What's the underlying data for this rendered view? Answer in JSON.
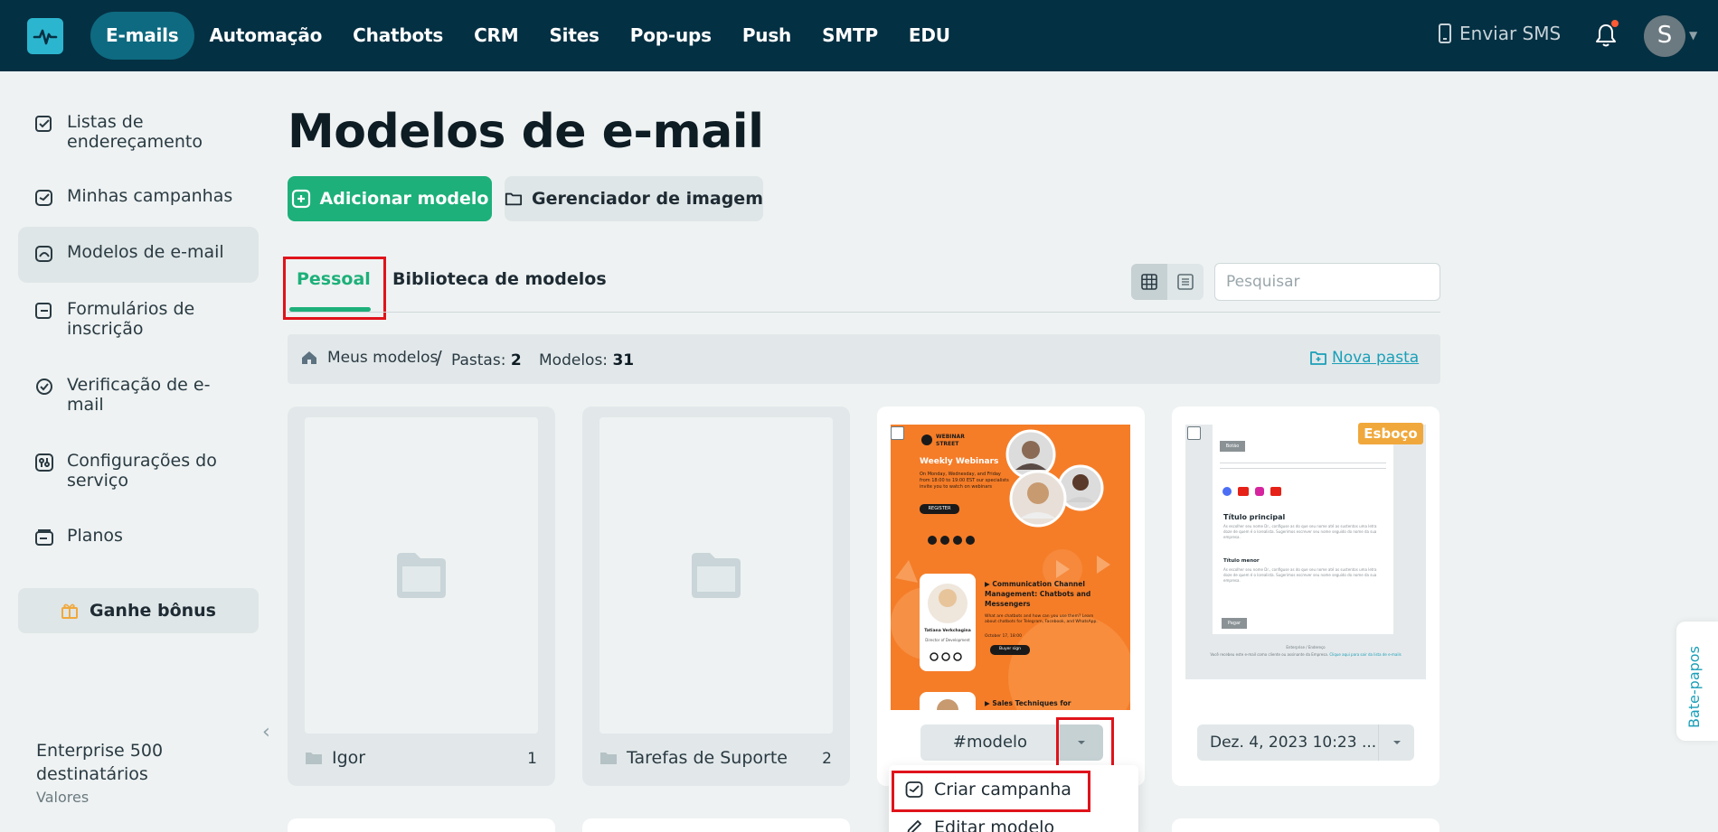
{
  "nav": {
    "items": [
      "E-mails",
      "Automação",
      "Chatbots",
      "CRM",
      "Sites",
      "Pop-ups",
      "Push",
      "SMTP",
      "EDU"
    ],
    "active_index": 0,
    "sms_label": "Enviar SMS",
    "avatar_letter": "S"
  },
  "sidebar": {
    "items": [
      {
        "label": "Listas de endereçamento",
        "icon": "address-list-icon"
      },
      {
        "label": "Minhas campanhas",
        "icon": "campaign-icon"
      },
      {
        "label": "Modelos de e-mail",
        "icon": "template-icon"
      },
      {
        "label": "Formulários de inscrição",
        "icon": "form-icon"
      },
      {
        "label": "Verificação de e-mail",
        "icon": "check-circle-icon"
      },
      {
        "label": "Configurações do serviço",
        "icon": "settings-icon"
      },
      {
        "label": "Planos",
        "icon": "wallet-icon"
      }
    ],
    "active_index": 2,
    "bonus_label": "Ganhe bônus",
    "plan_name": "Enterprise 500 destinatários",
    "plan_values": "Valores"
  },
  "main": {
    "title": "Modelos de e-mail",
    "add_button": "Adicionar modelo",
    "image_manager_button": "Gerenciador de imagem",
    "tabs": [
      "Pessoal",
      "Biblioteca de modelos"
    ],
    "search_placeholder": "Pesquisar",
    "breadcrumb": {
      "root": "Meus modelos",
      "sep": "/",
      "folders_label": "Pastas:",
      "folders_count": "2",
      "templates_label": "Modelos:",
      "templates_count": "31",
      "new_folder": "Nova pasta"
    },
    "folders": [
      {
        "name": "Igor",
        "count": "1"
      },
      {
        "name": "Tarefas de Suporte",
        "count": "2"
      }
    ],
    "templates": [
      {
        "name": "#modelo"
      },
      {
        "date": "Dez. 4, 2023 10:23 ...",
        "badge": "Esboço"
      }
    ],
    "dropdown_menu": [
      "Criar campanha",
      "Editar modelo"
    ]
  },
  "webinar_thumb": {
    "brand": "WEBINAR",
    "brand2": "STREET",
    "heading": "Weekly Webinars",
    "body": "On Monday, Wednesday, and Friday from 18:00 to 19:00 EST our specialists invite you to watch on webinars",
    "register": "REGISTER",
    "talk1_title": "Communication Channel Management: Chatbots and Messengers",
    "talk1_text": "What are chatbots and how can you use them? Learn about chatbots for Telegram, Facebook, and WhatsApp.",
    "talk1_date": "October 17, 18:00",
    "talk1_btn": "Buyer sign",
    "speaker_name": "Tatiana Verkchagina",
    "speaker_role": "Director of Development",
    "talk2_title": "Sales Techniques for"
  },
  "draft_thumb": {
    "top_btn": "Botão",
    "title": "Título principal",
    "subtitle": "Título menor",
    "bottom_btn": "Pagar",
    "footer": "Enterprise / Endereço",
    "footer2": "Você recebeu este e-mail como cliente ou assinante da Empresa.",
    "footer_link": "Clique aqui para sair da lista de e-mails",
    "lorem": "As escolher seu nome Dr., configuse as do que seu nome até as sustentos uma letra doze de quem é o lorealista. Sugerimos escrever seu nome seguido do nome da sua empresa."
  },
  "chat_tab": "Bate-papos",
  "colors": {
    "topbar": "#043043",
    "accent_green": "#1db07a",
    "link_blue": "#1a9fb8",
    "highlight_red": "#e0131b",
    "draft_badge": "#f0a83c",
    "webinar_orange": "#f57d28"
  }
}
